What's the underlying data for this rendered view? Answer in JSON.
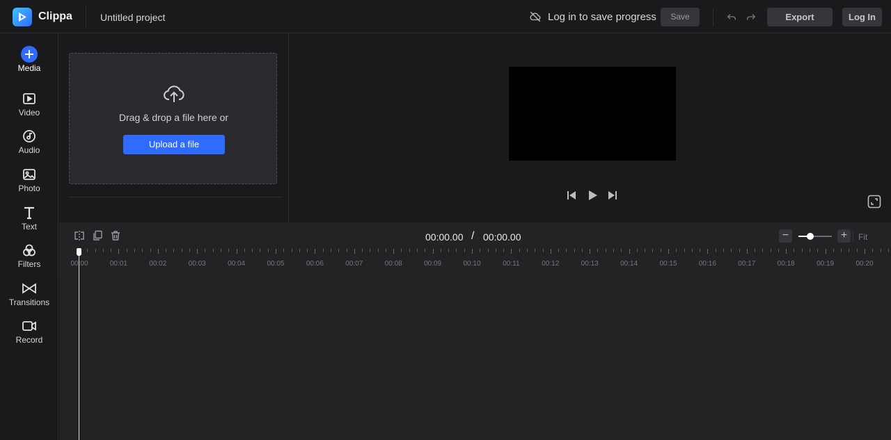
{
  "header": {
    "brand": "Clippa",
    "project_name": "Untitled project",
    "login_hint": "Log in to save progress",
    "save_label": "Save",
    "export_label": "Export",
    "login_label": "Log In",
    "icons": [
      "cloud-off-icon",
      "undo-icon",
      "redo-icon"
    ]
  },
  "sidebar": {
    "items": [
      {
        "label": "Media",
        "icon": "plus-circle-icon",
        "active": true
      },
      {
        "label": "Video",
        "icon": "video-icon",
        "active": false
      },
      {
        "label": "Audio",
        "icon": "music-note-icon",
        "active": false
      },
      {
        "label": "Photo",
        "icon": "image-icon",
        "active": false
      },
      {
        "label": "Text",
        "icon": "text-icon",
        "active": false
      },
      {
        "label": "Filters",
        "icon": "filters-icon",
        "active": false
      },
      {
        "label": "Transitions",
        "icon": "bowtie-icon",
        "active": false
      },
      {
        "label": "Record",
        "icon": "camera-icon",
        "active": false
      }
    ]
  },
  "media_panel": {
    "drop_text": "Drag & drop a file here or",
    "upload_label": "Upload a file"
  },
  "timeline": {
    "current_time": "00:00.00",
    "separator": "/",
    "total_time": "00:00.00",
    "fit_label": "Fit",
    "zoom_level": 0.35,
    "ruler_labels": [
      "00:00",
      "00:01",
      "00:02",
      "00:03",
      "00:04",
      "00:05",
      "00:06",
      "00:07",
      "00:08",
      "00:09",
      "00:10",
      "00:11",
      "00:12",
      "00:13",
      "00:14",
      "00:15",
      "00:16",
      "00:17",
      "00:18",
      "00:19",
      "00:20"
    ]
  },
  "colors": {
    "accent": "#2f6bff",
    "background": "#1a1a1c",
    "timeline_bg": "#232326"
  }
}
